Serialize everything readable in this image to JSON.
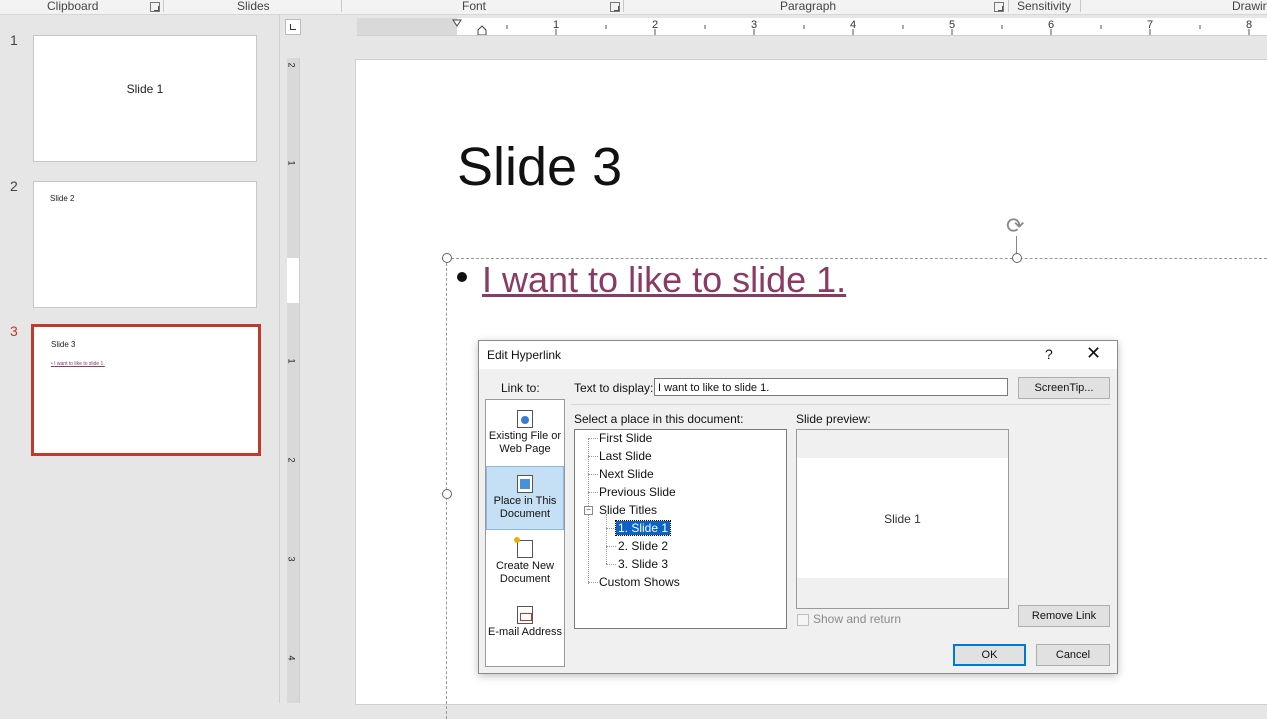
{
  "ribbon": {
    "groups": [
      "Clipboard",
      "Slides",
      "Font",
      "Paragraph",
      "Sensitivity",
      "Drawin"
    ]
  },
  "ruler": {
    "top_numbers": [
      "1",
      "2",
      "3",
      "4",
      "5",
      "6",
      "7",
      "8"
    ],
    "left_numbers": [
      "2",
      "1",
      "1",
      "2",
      "3",
      "4"
    ]
  },
  "thumbnails": [
    {
      "number": "1",
      "title": "Slide 1"
    },
    {
      "number": "2",
      "title": "Slide 2"
    },
    {
      "number": "3",
      "title": "Slide 3",
      "bullet": "I want to like to slide 1."
    }
  ],
  "slide": {
    "title": "Slide 3",
    "bullet_link": "I want to like to slide 1."
  },
  "dialog": {
    "title": "Edit Hyperlink",
    "help_glyph": "?",
    "close_glyph": "✕",
    "link_to_label": "Link to:",
    "link_to_items": [
      {
        "label": "Existing File or Web Page",
        "icon": "web-page-icon"
      },
      {
        "label": "Place in This Document",
        "icon": "place-in-document-icon"
      },
      {
        "label": "Create New Document",
        "icon": "new-document-icon"
      },
      {
        "label": "E-mail Address",
        "icon": "email-icon"
      }
    ],
    "text_to_display_label": "Text to display:",
    "text_to_display_value": "I want to like to slide 1.",
    "screentip_button": "ScreenTip...",
    "select_place_label": "Select a place in this document:",
    "tree": {
      "first": "First Slide",
      "last": "Last Slide",
      "next": "Next Slide",
      "previous": "Previous Slide",
      "slide_titles": "Slide Titles",
      "expander_glyph": "−",
      "children": [
        "1. Slide 1",
        "2. Slide 2",
        "3. Slide 3"
      ],
      "custom_shows": "Custom Shows"
    },
    "slide_preview_label": "Slide preview:",
    "preview_text": "Slide 1",
    "show_and_return": "Show and return",
    "remove_link_button": "Remove Link",
    "ok_button": "OK",
    "cancel_button": "Cancel"
  },
  "colors": {
    "selection_border": "#c0392b",
    "hyperlink": "#8a3b63",
    "active_linkto": "#c5dff5",
    "tree_selection": "#0a64c8"
  }
}
